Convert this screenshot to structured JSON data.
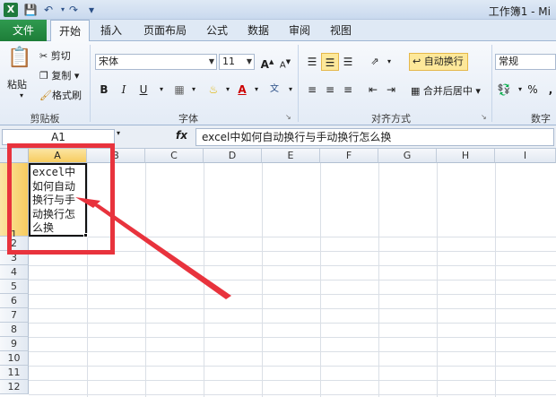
{
  "titlebar": {
    "app_icon": "X",
    "title": "工作簿1 - Mi"
  },
  "tabs": {
    "file": "文件",
    "items": [
      "开始",
      "插入",
      "页面布局",
      "公式",
      "数据",
      "审阅",
      "视图"
    ]
  },
  "clipboard": {
    "paste": "粘贴",
    "cut": "剪切",
    "copy": "复制",
    "format_painter": "格式刷",
    "group": "剪贴板"
  },
  "font": {
    "name": "宋体",
    "size": "11",
    "bold": "B",
    "italic": "I",
    "underline": "U",
    "group": "字体"
  },
  "alignment": {
    "wrap": "自动换行",
    "merge": "合并后居中",
    "group": "对齐方式"
  },
  "number": {
    "format": "常规",
    "percent": "%",
    "group": "数字"
  },
  "formula_bar": {
    "name_box": "A1",
    "fx": "fx",
    "content": "excel中如何自动换行与手动换行怎么换"
  },
  "sheet": {
    "columns": [
      "A",
      "B",
      "C",
      "D",
      "E",
      "F",
      "G",
      "H",
      "I"
    ],
    "rows": [
      "1",
      "2",
      "3",
      "4",
      "5",
      "6",
      "7",
      "8",
      "9",
      "10",
      "11",
      "12"
    ],
    "a1_lines": [
      "excel中",
      "如何自动",
      "换行与手",
      "动换行怎",
      "么换"
    ]
  },
  "colors": {
    "file_tab": "#1d7d38",
    "highlight": "#fde89a",
    "annotation": "#e8333d"
  }
}
